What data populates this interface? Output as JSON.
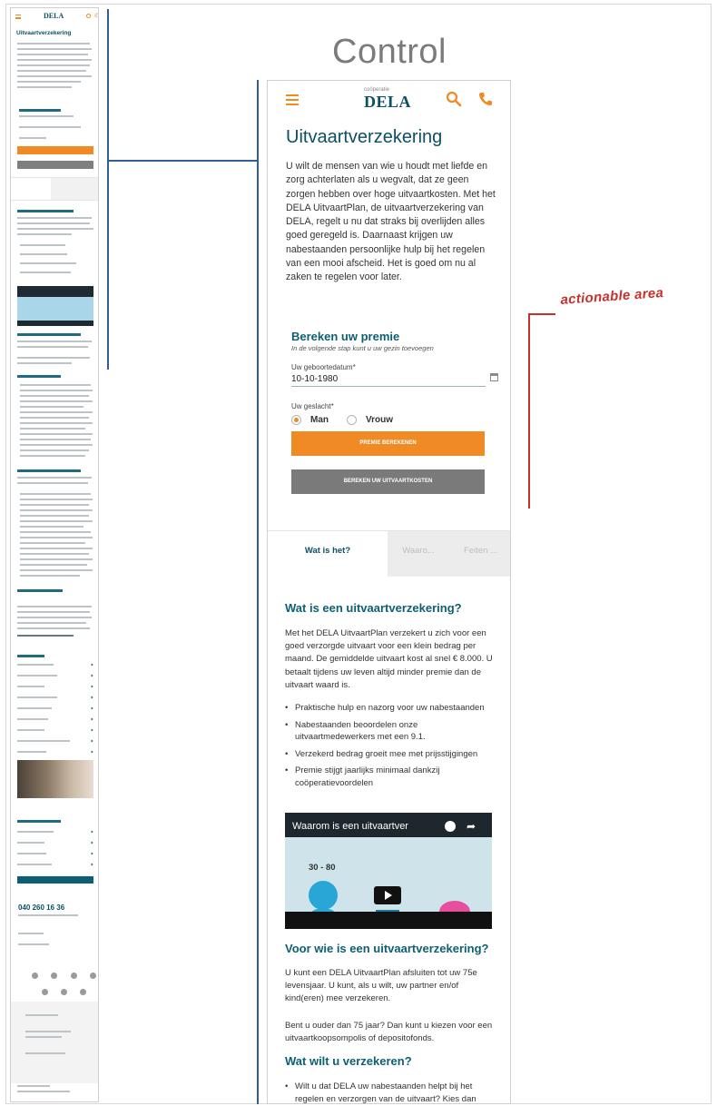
{
  "variant_label": "Control",
  "annotation_label": "actionable area",
  "thumbnail": {
    "logo": "DELA",
    "title": "Uitvaartverzekering",
    "phone": "040 260 16 36"
  },
  "header": {
    "logo_small": "coöperatie",
    "logo": "DELA"
  },
  "page": {
    "title": "Uitvaartverzekering",
    "intro": "U wilt de mensen van wie u houdt met liefde en zorg achterlaten als u wegvalt, dat ze geen zorgen hebben over hoge uitvaartkosten. Met het DELA UitvaartPlan, de uitvaartverzekering van DELA, regelt u nu dat straks bij overlijden alles goed geregeld is. Daarnaast krijgen uw nabestaanden persoonlijke hulp bij het regelen van een mooi afscheid. Het is goed om nu al zaken te regelen voor later."
  },
  "calculator": {
    "title": "Bereken uw premie",
    "subtitle": "In de volgende stap kunt u uw gezin toevoegen",
    "dob_label": "Uw geboortedatum*",
    "dob_value": "10-10-1980",
    "gender_label": "Uw geslacht*",
    "gender_options": [
      "Man",
      "Vrouw"
    ],
    "gender_selected": "Man",
    "primary_button": "Premie berekenen",
    "secondary_button": "Bereken uw uitvaartkosten"
  },
  "tabs": [
    "Wat is het?",
    "Waaro...",
    "Feiten ..."
  ],
  "content": {
    "h_what": "Wat is een uitvaartverzekering?",
    "p_what": "Met het DELA UitvaartPlan verzekert u zich voor een goed verzorgde uitvaart voor een klein bedrag per maand. De gemiddelde uitvaart kost al snel € 8.000. U betaalt tijdens uw leven altijd minder premie dan de uitvaart waard is.",
    "bullets": [
      "Praktische hulp en nazorg voor uw nabestaanden",
      "Nabestaanden beoordelen onze uitvaartmedewerkers met een 9.1.",
      "Verzekerd bedrag groeit mee met prijsstijgingen",
      "Premie stijgt jaarlijks minimaal dankzij coöperatievoordelen"
    ],
    "video_title": "Waarom is een uitvaartver",
    "video_number": "30 - 80",
    "h_who": "Voor wie is een uitvaartverzekering?",
    "p_who_1": "U kunt een DELA UitvaartPlan afsluiten tot uw 75e levensjaar. U kunt, als u wilt, uw partner en/of kind(eren) mee verzekeren.",
    "p_who_2": "Bent u ouder dan 75 jaar? Dan kunt u kiezen voor een uitvaartkoopsompolis of depositofonds.",
    "h_insure": "Wat wilt u verzekeren?",
    "bullet_insure": "Wilt u dat DELA uw nabestaanden helpt bij het regelen en verzorgen van de uitvaart? Kies dan"
  },
  "colors": {
    "brand": "#0d4f63",
    "accent": "#f08a24",
    "annotation": "#c9302c",
    "connector": "#2f5f9a"
  }
}
